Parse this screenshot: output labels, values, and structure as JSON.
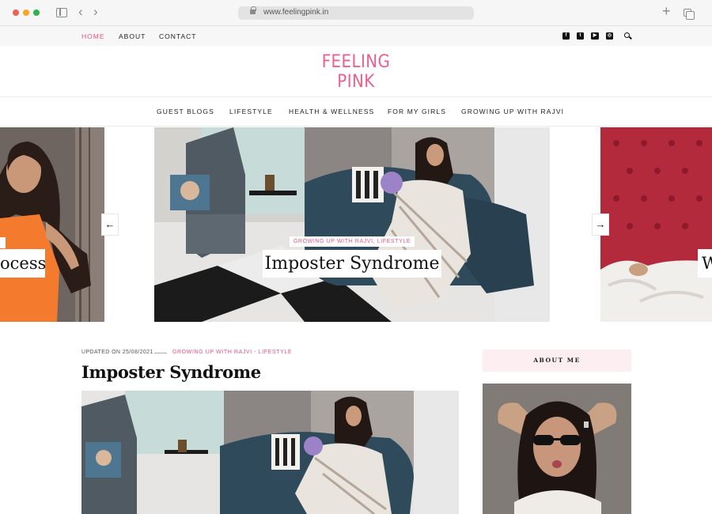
{
  "browser": {
    "url": "www.feelingpink.in"
  },
  "topnav": {
    "items": [
      {
        "label": "HOME",
        "active": true
      },
      {
        "label": "ABOUT",
        "active": false
      },
      {
        "label": "CONTACT",
        "active": false
      }
    ],
    "social_icons": [
      "facebook-icon",
      "twitter-icon",
      "youtube-icon",
      "instagram-icon"
    ],
    "search_icon": "search-icon"
  },
  "logo": {
    "line1": "FEELING",
    "line2": "PINK",
    "color": "#ec5f8c"
  },
  "mainnav": {
    "items": [
      {
        "label": "GUEST BLOGS"
      },
      {
        "label": "LIFESTYLE"
      },
      {
        "label": "HEALTH & WELLNESS"
      },
      {
        "label": "FOR MY GIRLS"
      },
      {
        "label": "GROWING UP WITH RAJVI"
      }
    ]
  },
  "slider": {
    "left_caption": "ocess",
    "center_categories": "GROWING UP WITH RAJVI, LIFESTYLE",
    "center_caption": "Imposter Syndrome",
    "right_caption": "W",
    "prev_icon": "arrow-left-icon",
    "next_icon": "arrow-right-icon"
  },
  "post": {
    "updated": "UPDATED ON 25/08/2021",
    "categories": "GROWING UP WITH RAJVI - LIFESTYLE",
    "title": "Imposter Syndrome"
  },
  "sidebar": {
    "about_heading": "ABOUT ME"
  },
  "colors": {
    "accent": "#e8537f",
    "about_bg": "#fdeef2"
  }
}
